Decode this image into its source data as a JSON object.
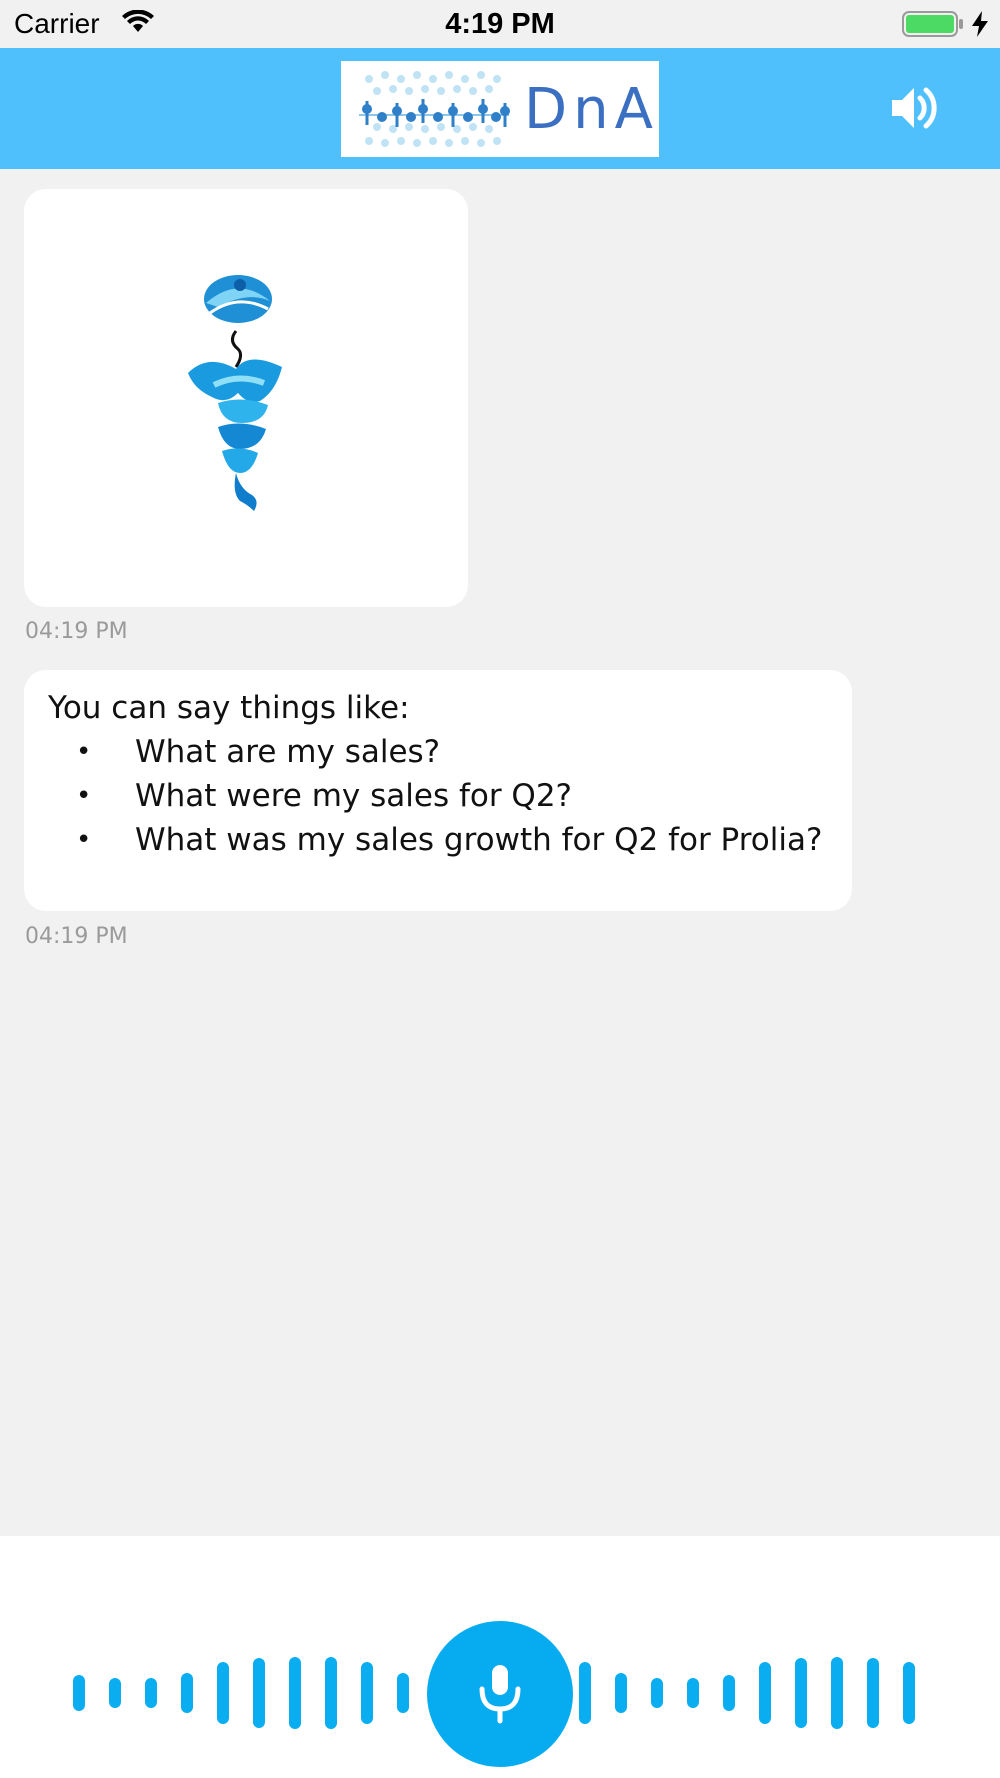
{
  "status_bar": {
    "carrier": "Carrier",
    "time": "4:19 PM",
    "battery_color": "#4cd964"
  },
  "header": {
    "logo_text": "DnA",
    "background": "#50c0fc",
    "speaker_icon": "speaker-volume-icon"
  },
  "messages": [
    {
      "type": "image",
      "image": "genie-illustration",
      "timestamp": "04:19 PM"
    },
    {
      "type": "text",
      "intro": "You can say things like:",
      "suggestions": [
        "What are my sales?",
        "What were my sales for Q2?",
        "What was my sales growth for Q2 for Prolia?"
      ],
      "bullet": "•",
      "timestamp": "04:19 PM"
    }
  ],
  "voice_bar": {
    "mic_icon": "microphone-icon",
    "accent": "#06acef"
  }
}
